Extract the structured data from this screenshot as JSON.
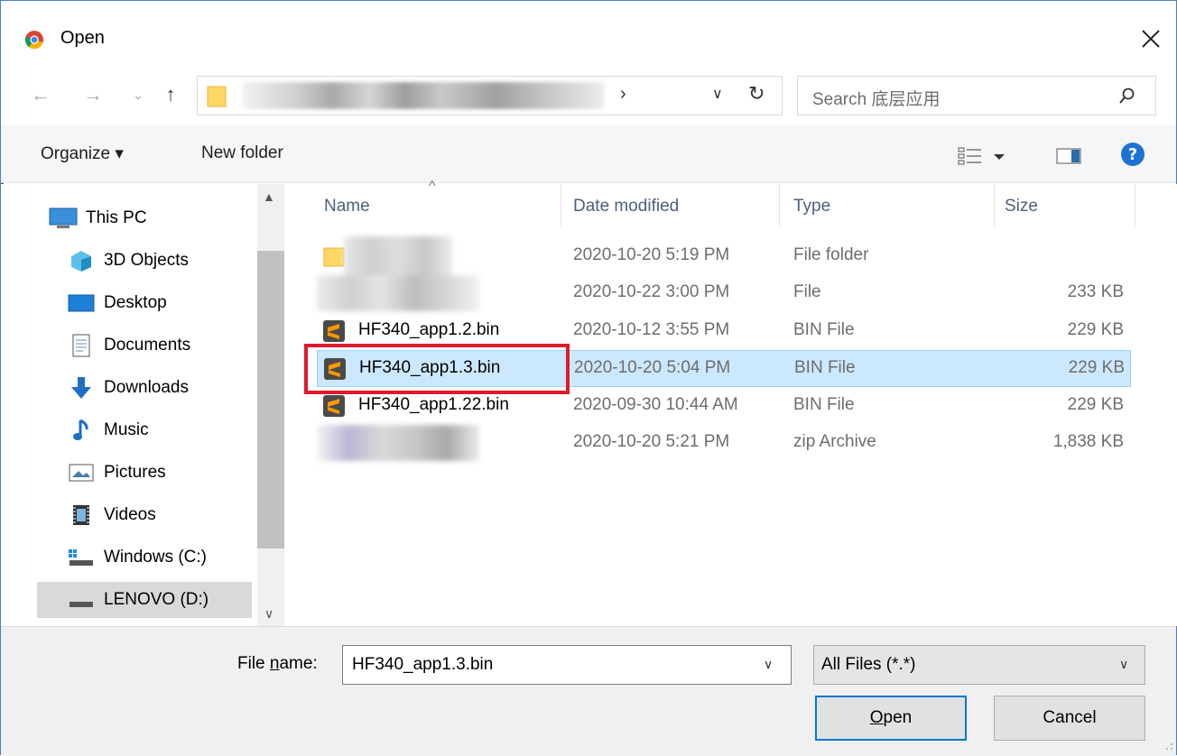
{
  "window": {
    "title": "Open"
  },
  "address": {
    "chevron": "›"
  },
  "search": {
    "placeholder": "Search 底层应用"
  },
  "toolbar": {
    "organize_label": "Organize ▾",
    "new_folder_label": "New folder"
  },
  "nav_pane": {
    "items": [
      {
        "label": "This PC",
        "icon": "computer-icon"
      },
      {
        "label": "3D Objects",
        "icon": "cube-icon"
      },
      {
        "label": "Desktop",
        "icon": "desktop-icon"
      },
      {
        "label": "Documents",
        "icon": "documents-icon"
      },
      {
        "label": "Downloads",
        "icon": "download-icon"
      },
      {
        "label": "Music",
        "icon": "music-icon"
      },
      {
        "label": "Pictures",
        "icon": "pictures-icon"
      },
      {
        "label": "Videos",
        "icon": "videos-icon"
      },
      {
        "label": "Windows (C:)",
        "icon": "drive-icon"
      },
      {
        "label": "LENOVO (D:)",
        "icon": "drive-icon"
      }
    ]
  },
  "file_list": {
    "columns": {
      "name": "Name",
      "date": "Date modified",
      "type": "Type",
      "size": "Size"
    },
    "rows": [
      {
        "name": "",
        "date": "2020-10-20 5:19 PM",
        "type": "File folder",
        "size": ""
      },
      {
        "name": "",
        "date": "2020-10-22 3:00 PM",
        "type": "File",
        "size": "233 KB"
      },
      {
        "name": "HF340_app1.2.bin",
        "date": "2020-10-12 3:55 PM",
        "type": "BIN File",
        "size": "229 KB"
      },
      {
        "name": "HF340_app1.3.bin",
        "date": "2020-10-20 5:04 PM",
        "type": "BIN File",
        "size": "229 KB"
      },
      {
        "name": "HF340_app1.22.bin",
        "date": "2020-09-30 10:44 AM",
        "type": "BIN File",
        "size": "229 KB"
      },
      {
        "name": "",
        "date": "2020-10-20 5:21 PM",
        "type": "zip Archive",
        "size": "1,838 KB"
      }
    ]
  },
  "bottom": {
    "file_name_label_prefix": "File ",
    "file_name_label_underlined": "n",
    "file_name_label_suffix": "ame:",
    "file_name_value": "HF340_app1.3.bin",
    "filter_value": "All Files (*.*)",
    "open_label_underlined": "O",
    "open_label_rest": "pen",
    "cancel_label": "Cancel"
  },
  "colors": {
    "accent": "#0078d7",
    "selection": "#cce8ff",
    "highlight": "#e0182b"
  }
}
